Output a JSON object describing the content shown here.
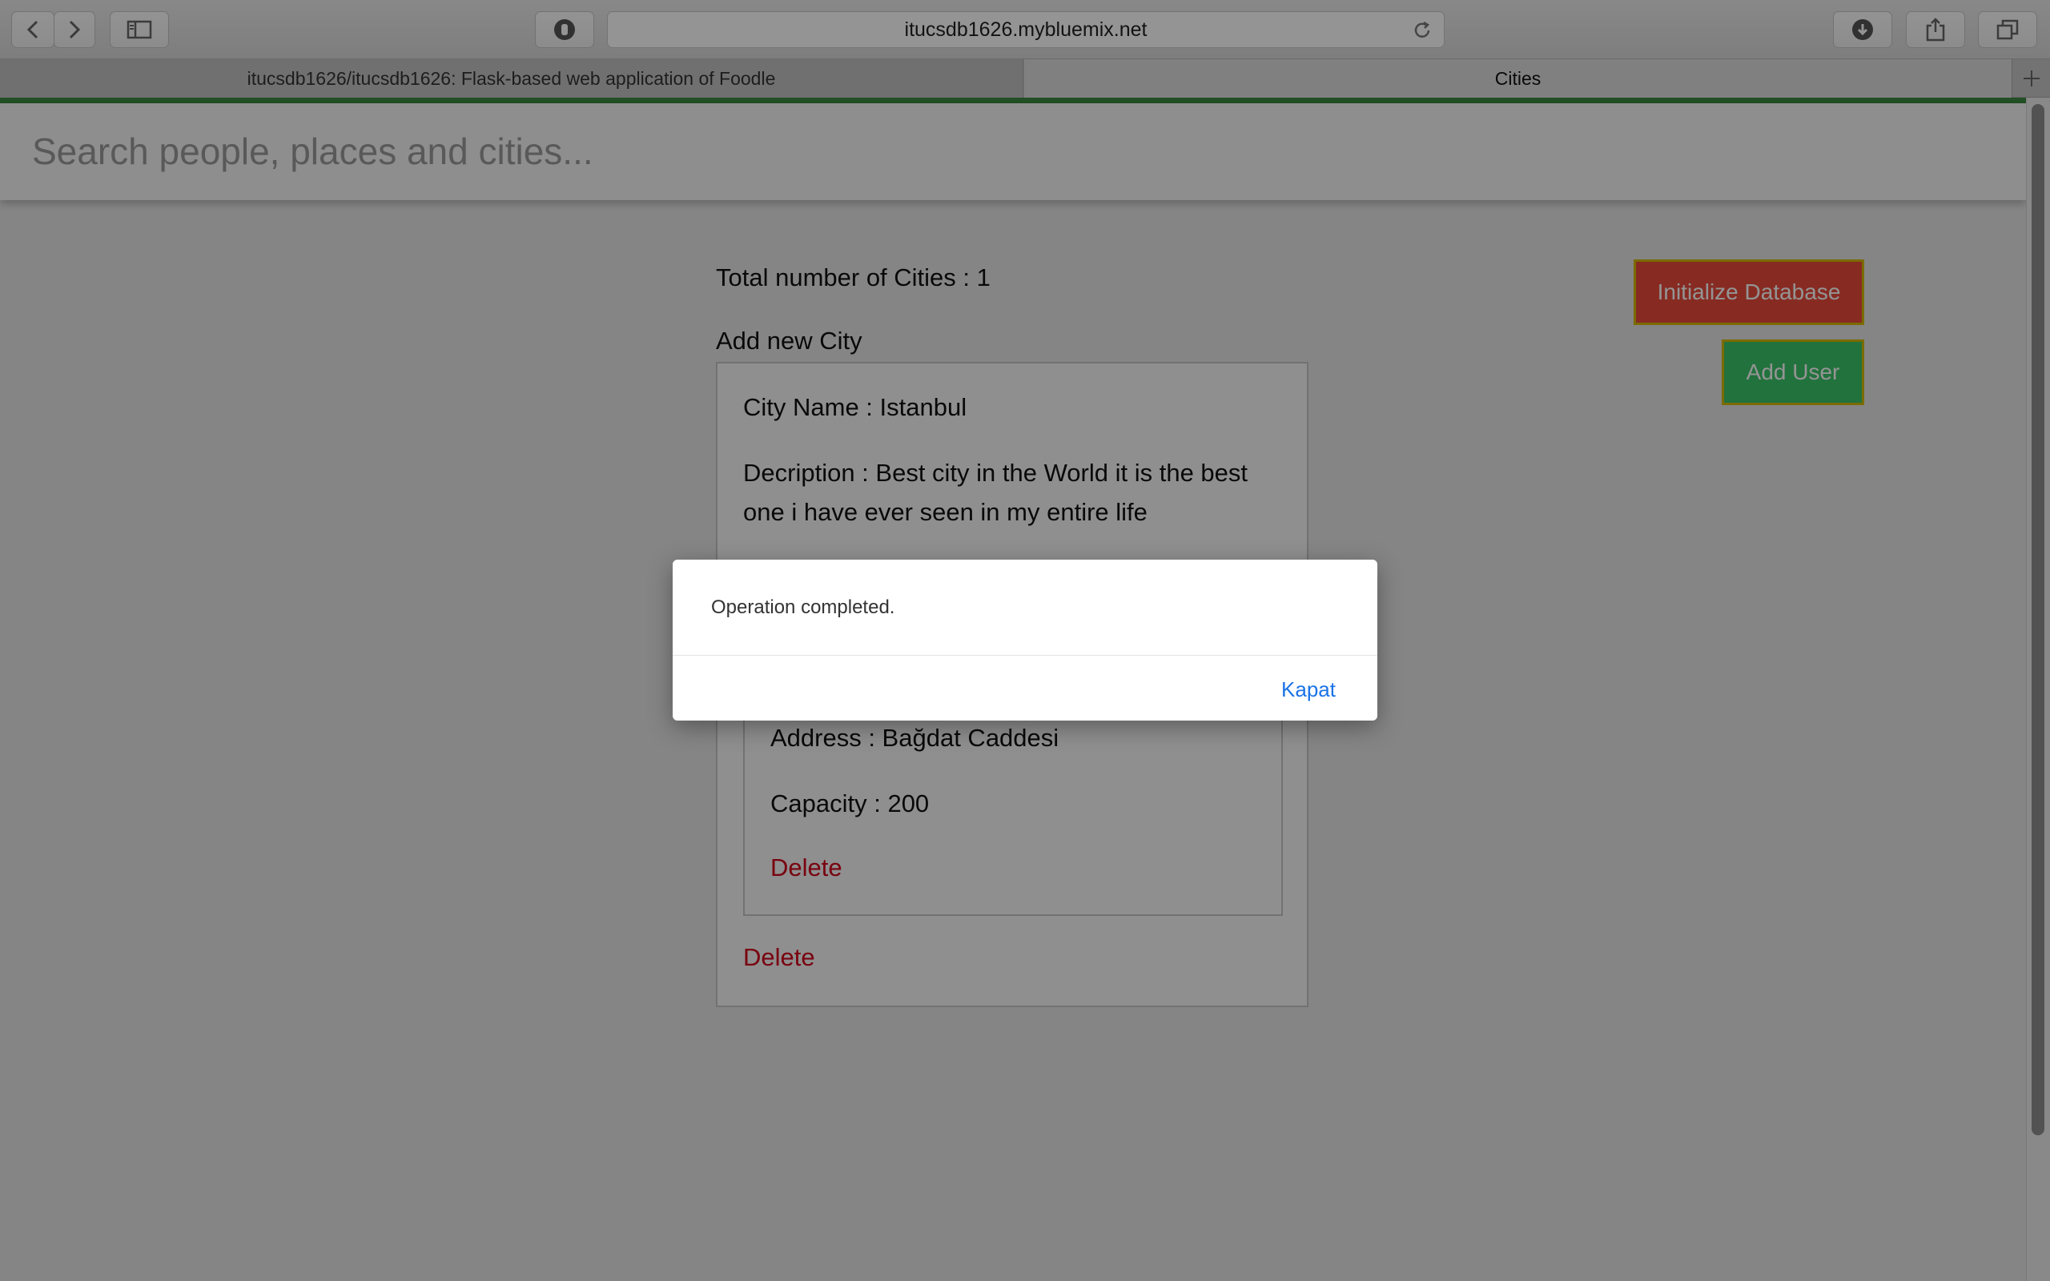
{
  "browser": {
    "url": "itucsdb1626.mybluemix.net",
    "tabs": [
      {
        "label": "itucsdb1626/itucsdb1626: Flask-based web application of Foodle"
      },
      {
        "label": "Cities"
      }
    ],
    "icons": {
      "back": "chevron-left-icon",
      "forward": "chevron-right-icon",
      "sidebar": "sidebar-icon",
      "privacy": "hand-shield-icon",
      "reload": "reload-icon",
      "download": "download-icon",
      "share": "share-icon",
      "tabs": "tabs-overview-icon",
      "new_tab": "plus-icon"
    }
  },
  "search": {
    "placeholder": "Search people, places and cities..."
  },
  "main": {
    "total_cities": "Total number of Cities : 1",
    "add_city_label": "Add new City",
    "city": {
      "name": "City Name : Istanbul",
      "description": "Decription : Best city in the World it is the best one i have ever seen in my entire life",
      "venue": {
        "address": "Address : Bağdat Caddesi",
        "capacity": "Capacity : 200",
        "delete_label": "Delete"
      },
      "delete_label": "Delete"
    },
    "buttons": {
      "init_db": "Initialize Database",
      "add_user": "Add User"
    }
  },
  "colors": {
    "accent_green": "#3c8a3f",
    "init_button": "#e94b3c",
    "add_user_button": "#3cc46a",
    "button_border": "#d4b800",
    "delete_red": "#d0021b",
    "dialog_link": "#1a73e8"
  },
  "dialog": {
    "message": "Operation completed.",
    "close_label": "Kapat"
  }
}
